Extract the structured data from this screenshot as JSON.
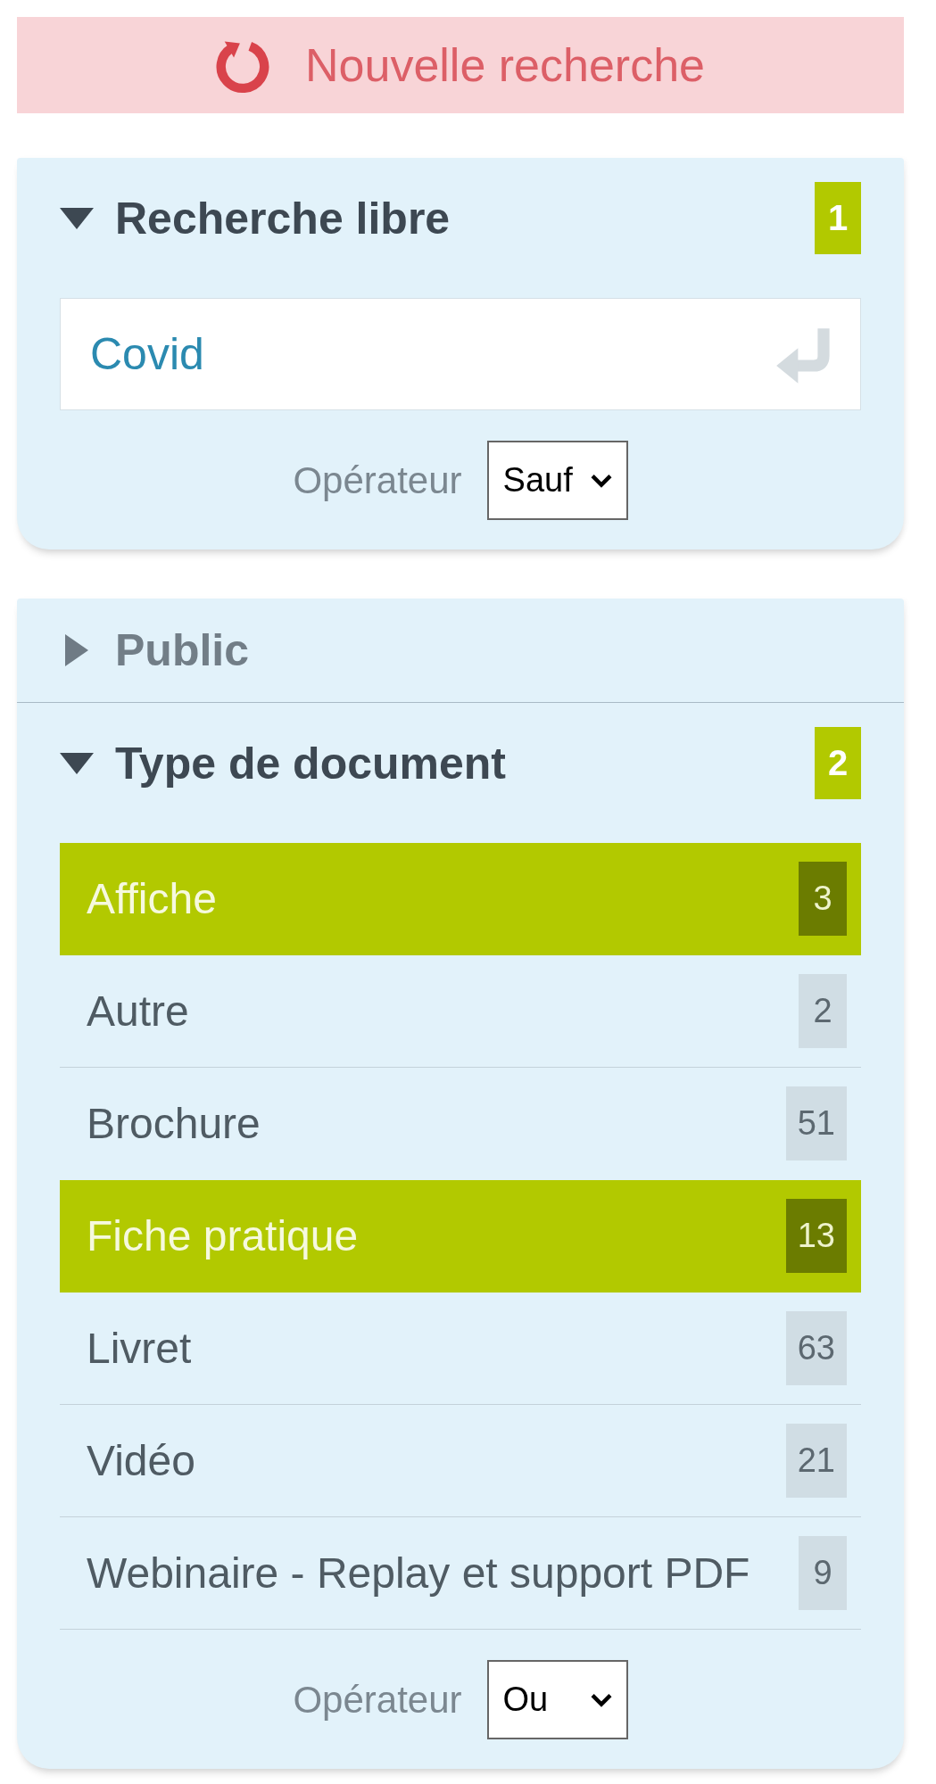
{
  "new_search_button": {
    "label": "Nouvelle recherche"
  },
  "cards": [
    {
      "sections": [
        {
          "title": "Recherche libre",
          "expanded": true,
          "badge": "1",
          "kind": "text",
          "field": {
            "value": "Covid"
          },
          "operator": {
            "label": "Opérateur",
            "value": "Sauf"
          }
        }
      ]
    },
    {
      "sections": [
        {
          "title": "Public",
          "expanded": false
        },
        {
          "title": "Type de document",
          "expanded": true,
          "badge": "2",
          "kind": "list",
          "items": [
            {
              "label": "Affiche",
              "count": "3",
              "selected": true
            },
            {
              "label": "Autre",
              "count": "2",
              "selected": false
            },
            {
              "label": "Brochure",
              "count": "51",
              "selected": false
            },
            {
              "label": "Fiche pratique",
              "count": "13",
              "selected": true
            },
            {
              "label": "Livret",
              "count": "63",
              "selected": false
            },
            {
              "label": "Vidéo",
              "count": "21",
              "selected": false
            },
            {
              "label": "Webinaire - Replay et support PDF",
              "count": "9",
              "selected": false
            }
          ],
          "operator": {
            "label": "Opérateur",
            "value": "Ou"
          }
        }
      ]
    }
  ]
}
